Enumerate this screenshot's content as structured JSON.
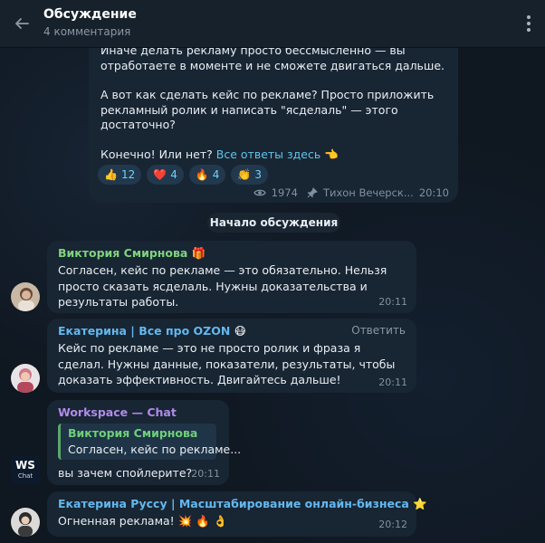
{
  "header": {
    "title": "Обсуждение",
    "subtitle": "4 комментария"
  },
  "post": {
    "paragraphs": [
      "Иначе делать рекламу просто бессмысленно — вы отработаете в моменте и не сможете двигаться дальше.",
      "А вот как сделать кейс по рекламе? Просто приложить рекламный ролик и написать \"ясделаль\" — этого достаточно?"
    ],
    "last_line": "Конечно! Или нет?",
    "link_text": "Все ответы здесь",
    "link_emoji": "👈",
    "reactions": [
      {
        "emoji": "👍",
        "count": "12"
      },
      {
        "emoji": "❤️",
        "count": "4"
      },
      {
        "emoji": "🔥",
        "count": "4"
      },
      {
        "emoji": "👏",
        "count": "3"
      }
    ],
    "views": "1974",
    "author": "Тихон Вечерск...",
    "time": "20:10"
  },
  "divider": "Начало обсуждения",
  "comments": [
    {
      "author": "Виктория Смирнова",
      "author_emoji": "🎁",
      "author_color": "#7fd37e",
      "text": "Согласен, кейс по рекламе — это обязательно. Нельзя просто сказать ясделаль. Нужны доказательства и результаты работы.",
      "time": "20:11"
    },
    {
      "author": "Екатерина | Все про OZON",
      "author_emoji": "😷",
      "author_color": "#63b8ee",
      "reply_label": "Ответить",
      "text": "Кейс по рекламе — это не просто ролик и фраза я сделал. Нужны данные, показатели, результаты, чтобы доказать эффективность. Двигайтесь дальше!",
      "time": "20:11"
    },
    {
      "author": "Workspace — Chat",
      "author_color": "#b08be8",
      "quote_author": "Виктория Смирнова",
      "quote_text": "Согласен, кейс по рекламе...",
      "text": "вы зачем спойлерите?",
      "time": "20:11",
      "avatar_text_top": "WS",
      "avatar_text_bottom": "Chat"
    },
    {
      "author": "Екатерина Руссу | Масштабирование онлайн-бизнеса",
      "author_emoji": "⭐",
      "author_color": "#63b8ee",
      "text": "Огненная реклама!",
      "text_emojis": "💥 🔥 👌",
      "time": "20:12"
    }
  ],
  "colors": {
    "background": "#0f1720",
    "header": "#17212b",
    "bubble": "#182533",
    "link": "#5fc5e9",
    "reaction_count": "#6ed2ff"
  }
}
